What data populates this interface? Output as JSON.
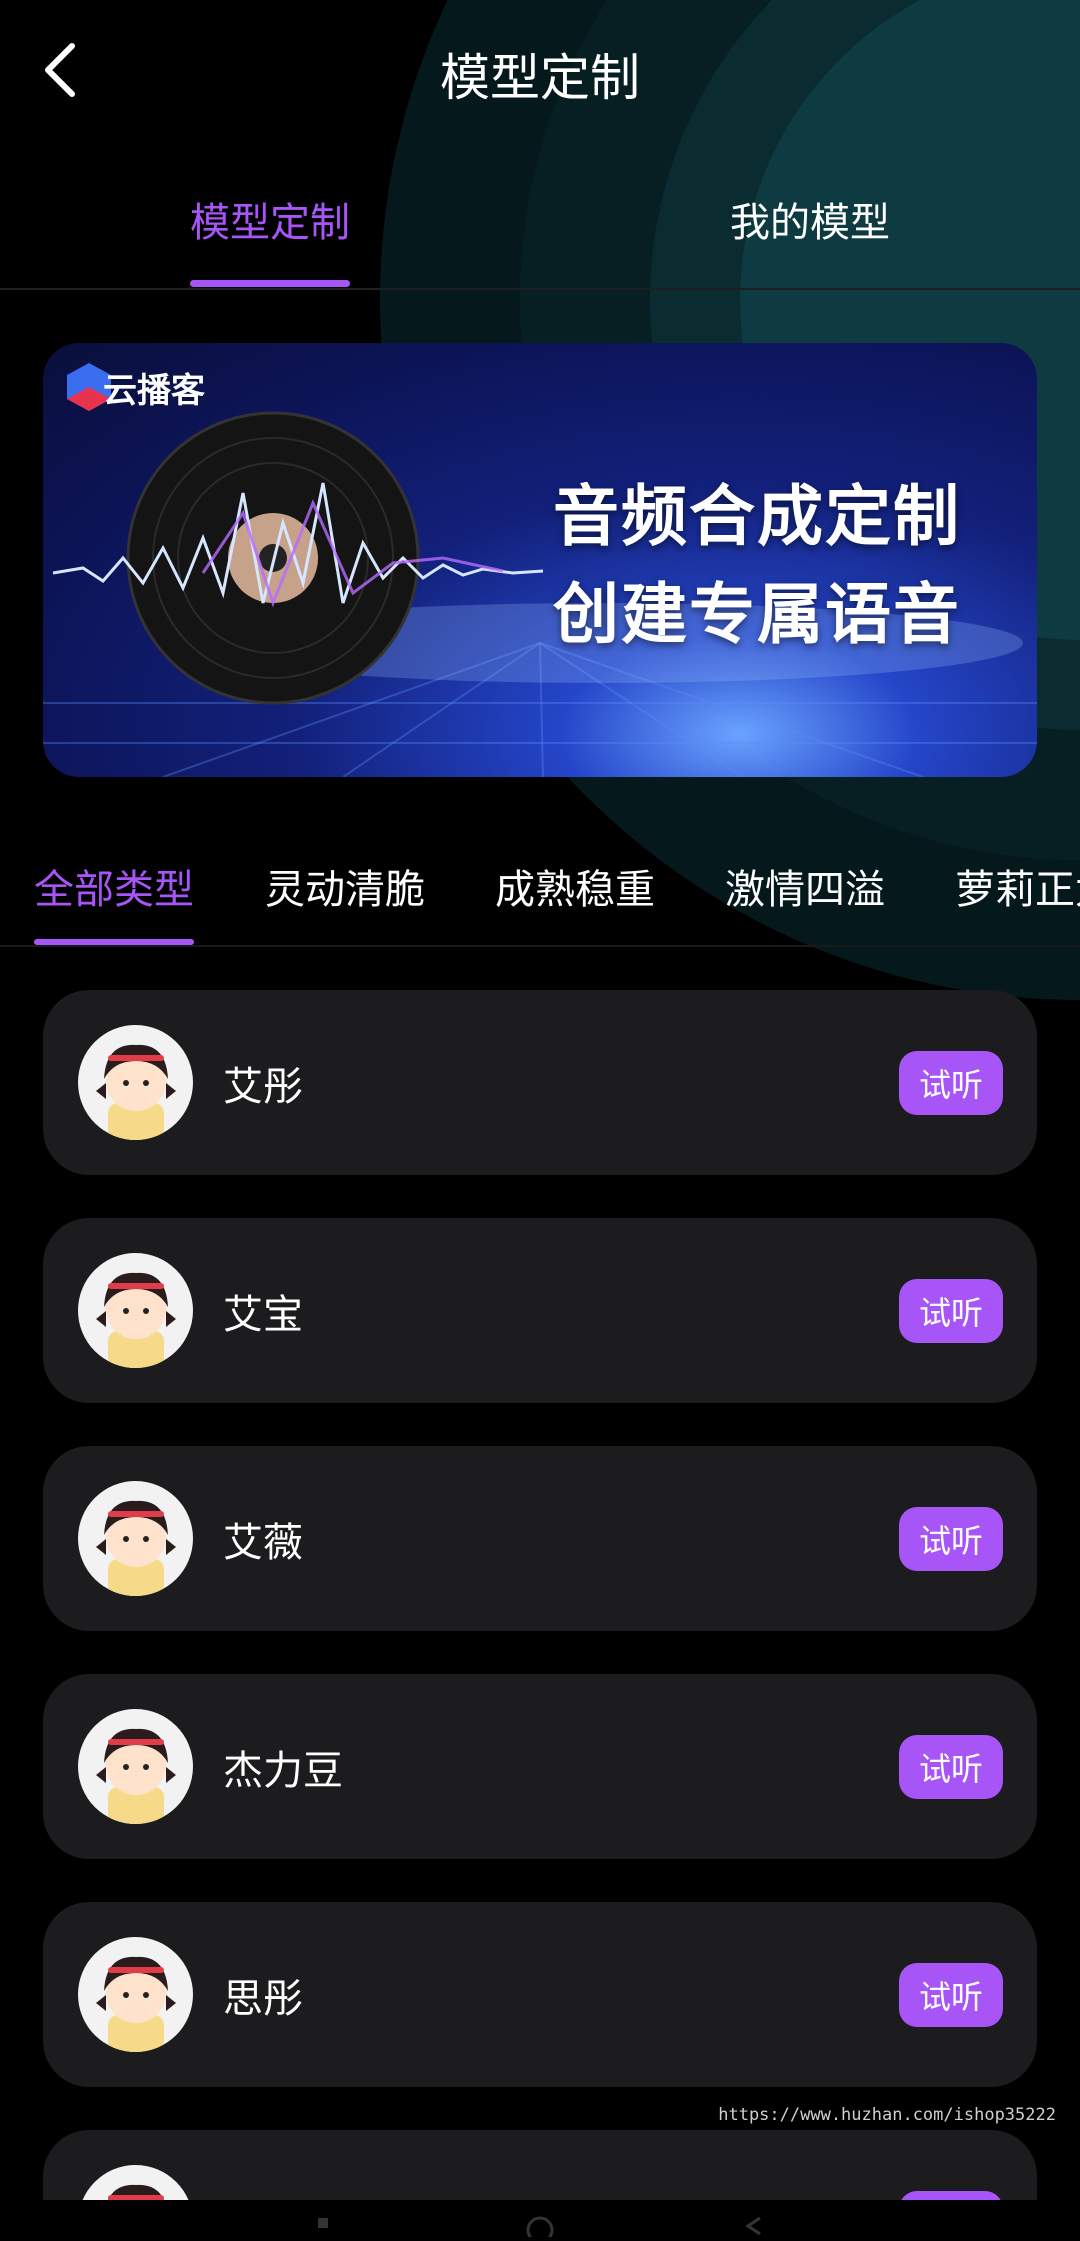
{
  "header": {
    "title": "模型定制"
  },
  "tabs": [
    {
      "label": "模型定制",
      "active": true
    },
    {
      "label": "我的模型",
      "active": false
    }
  ],
  "banner": {
    "brand": "云播客",
    "line1": "音频合成定制",
    "line2": "创建专属语音"
  },
  "categories": [
    {
      "label": "全部类型",
      "active": true
    },
    {
      "label": "灵动清脆"
    },
    {
      "label": "成熟稳重"
    },
    {
      "label": "激情四溢"
    },
    {
      "label": "萝莉正太"
    }
  ],
  "models": [
    {
      "name": "艾彤",
      "action": "试听"
    },
    {
      "name": "艾宝",
      "action": "试听"
    },
    {
      "name": "艾薇",
      "action": "试听"
    },
    {
      "name": "杰力豆",
      "action": "试听"
    },
    {
      "name": "思彤",
      "action": "试听"
    }
  ],
  "watermark": "https://www.huzhan.com/ishop35222",
  "colors": {
    "accent": "#a855f7",
    "card": "#1c1c1e",
    "background": "#000000"
  }
}
